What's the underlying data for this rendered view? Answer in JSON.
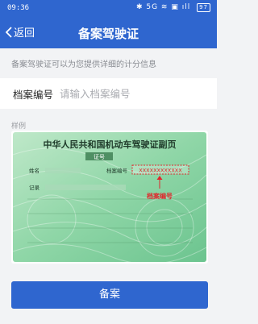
{
  "status_bar": {
    "time": "09:36",
    "indicators": "✱ 5G ≋ ▣ ıll",
    "battery": "97"
  },
  "nav": {
    "back_label": "返回",
    "title": "备案驾驶证"
  },
  "hint": "备案驾驶证可以为您提供详细的计分信息",
  "form": {
    "label": "档案编号",
    "value": "",
    "placeholder": "请输入档案编号"
  },
  "sample": {
    "label": "样例",
    "card_title": "中华人民共和国机动车驾驶证副页",
    "id_label": "证号",
    "name_label": "姓名",
    "file_no_label": "档案编号",
    "file_no_value": "XXXXXXXXXXXX",
    "record_label": "记录",
    "annotation": "档案编号",
    "highlight_color": "#e0262b",
    "card_color": "#7fcf9a"
  },
  "submit_label": "备案"
}
